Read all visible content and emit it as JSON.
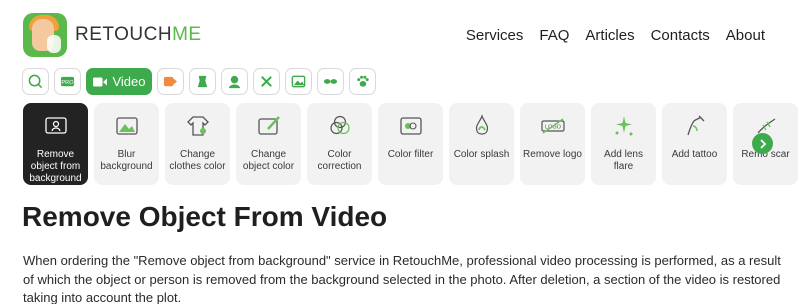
{
  "brand": {
    "name_prefix": "RETOUCH",
    "name_suffix": "ME",
    "accent": "#3daa4b"
  },
  "nav": {
    "items": [
      {
        "label": "Services"
      },
      {
        "label": "FAQ"
      },
      {
        "label": "Articles"
      },
      {
        "label": "Contacts"
      },
      {
        "label": "About"
      }
    ]
  },
  "categories": {
    "icons": [
      "search-icon",
      "pro-icon",
      "video-icon",
      "arrow-right-icon",
      "cloth-icon",
      "person-icon",
      "tools-icon",
      "gallery-icon",
      "glasses-icon",
      "paw-icon"
    ],
    "active_label": "Video"
  },
  "services": [
    {
      "label": "Remove object from background",
      "icon": "remove-object-icon",
      "active": true
    },
    {
      "label": "Blur background",
      "icon": "blur-icon"
    },
    {
      "label": "Change clothes color",
      "icon": "shirt-icon"
    },
    {
      "label": "Change object color",
      "icon": "brush-icon"
    },
    {
      "label": "Color correction",
      "icon": "color-circles-icon"
    },
    {
      "label": "Color filter",
      "icon": "filter-icon"
    },
    {
      "label": "Color splash",
      "icon": "splash-icon"
    },
    {
      "label": "Remove logo",
      "icon": "logo-icon"
    },
    {
      "label": "Add lens flare",
      "icon": "sparkle-icon"
    },
    {
      "label": "Add tattoo",
      "icon": "tattoo-icon"
    },
    {
      "label": "Remo scar",
      "icon": "scar-icon"
    }
  ],
  "page": {
    "title": "Remove Object From Video",
    "body": "When ordering the \"Remove object from background\" service in RetouchMe, professional video processing is performed, as a result of which the object or person is removed from the background selected in the photo. After deletion, a section of the video is restored taking into account the plot."
  }
}
